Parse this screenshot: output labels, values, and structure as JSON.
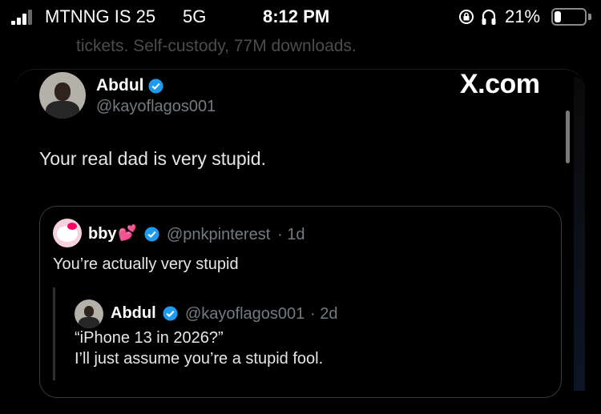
{
  "status_bar": {
    "carrier": "MTNNG IS 25",
    "network": "5G",
    "time": "8:12 PM",
    "battery_percent": "21%",
    "battery_level": 0.21,
    "icons": [
      "signal-icon",
      "orientation-lock-icon",
      "headphones-icon",
      "battery-icon"
    ]
  },
  "prev_post": {
    "text": "tickets. Self-custody, 77M downloads."
  },
  "tweet": {
    "author_name": "Abdul",
    "author_handle": "@kayoflagos001",
    "brand": "X.com",
    "text": "Your real dad is very stupid."
  },
  "quote": {
    "author_name": "bby",
    "author_emoji": "💕",
    "author_handle": "@pnkpinterest",
    "time": "· 1d",
    "text": "You’re actually very stupid",
    "nested": {
      "author_name": "Abdul",
      "author_handle": "@kayoflagos001",
      "time": "· 2d",
      "line1": "“iPhone 13 in 2026?”",
      "line2": "I’ll just assume you’re a stupid fool."
    }
  },
  "colors": {
    "verified": "#1d9bf0",
    "muted": "#747a80",
    "background": "#000000"
  }
}
